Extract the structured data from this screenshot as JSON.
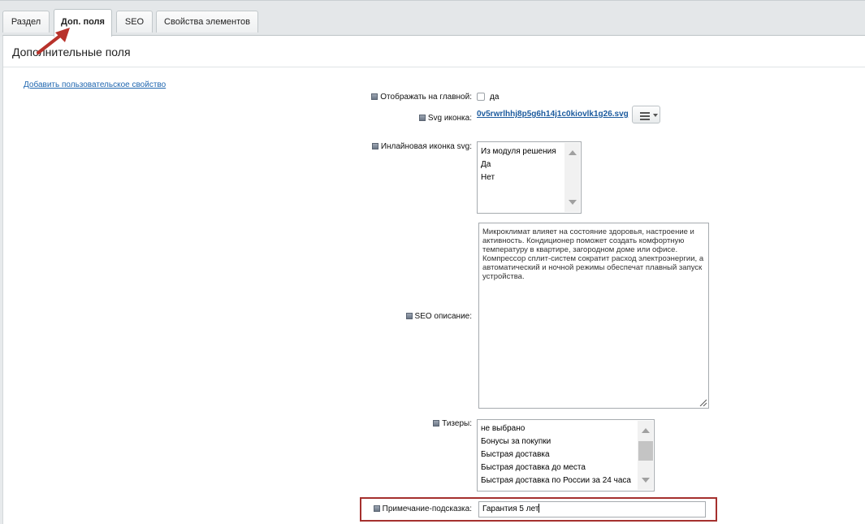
{
  "tabs": [
    {
      "label": "Раздел"
    },
    {
      "label": "Доп. поля"
    },
    {
      "label": "SEO"
    },
    {
      "label": "Свойства элементов"
    }
  ],
  "section": {
    "title": "Дополнительные поля",
    "add_property_link": "Добавить пользовательское свойство"
  },
  "fields": {
    "show_on_main": {
      "label": "Отображать на главной:",
      "checkbox_label": "да",
      "checked": false
    },
    "svg_icon": {
      "label": "Svg иконка:",
      "file_name": "0v5rwrlhhj8p5g6h14j1c0kiovlk1g26.svg"
    },
    "inline_svg": {
      "label": "Инлайновая иконка svg:",
      "options": [
        "Из модуля решения",
        "Да",
        "Нет"
      ]
    },
    "seo_description": {
      "label": "SEO описание:",
      "value": "Микроклимат влияет на состояние здоровья, настроение и активность. Кондиционер поможет создать комфортную температуру в квартире, загородном доме или офисе. Компрессор сплит-систем сократит расход электроэнергии, а автоматический и ночной режимы обеспечат плавный запуск устройства."
    },
    "teasers": {
      "label": "Тизеры:",
      "options": [
        "не выбрано",
        "Бонусы за покупки",
        "Быстрая доставка",
        "Быстрая доставка до места",
        "Быстрая доставка по России за 24 часа"
      ]
    },
    "tooltip_note": {
      "label": "Примечание-подсказка:",
      "value": "Гарантия 5 лет"
    }
  },
  "colors": {
    "annotation_red": "#b8322b",
    "link_blue": "#2067b0"
  },
  "icons": {
    "hint": "hint-square-icon",
    "menu": "hamburger-menu-icon",
    "annotation": "red-arrow-icon"
  }
}
